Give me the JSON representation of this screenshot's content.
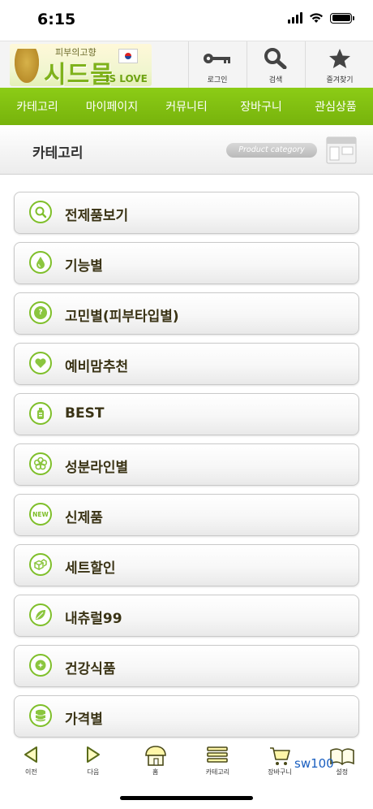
{
  "status_bar": {
    "time": "6:15"
  },
  "header": {
    "logo": {
      "subtitle": "피부의고향",
      "title": "시드물",
      "tagline": "IS LOVE"
    },
    "buttons": [
      {
        "label": "로그인",
        "icon": "key-icon"
      },
      {
        "label": "검색",
        "icon": "search-icon"
      },
      {
        "label": "즐겨찾기",
        "icon": "star-icon"
      }
    ]
  },
  "nav": {
    "items": [
      "카테고리",
      "마이페이지",
      "커뮤니티",
      "장바구니",
      "관심상품"
    ]
  },
  "category_bar": {
    "title": "카테고리",
    "badge": "Product category"
  },
  "menu": {
    "items": [
      {
        "label": "전제품보기",
        "icon": "magnifier-icon"
      },
      {
        "label": "기능별",
        "icon": "droplet-icon"
      },
      {
        "label": "고민별(피부타입별)",
        "icon": "question-icon"
      },
      {
        "label": "예비맘추천",
        "icon": "heart-icon"
      },
      {
        "label": "BEST",
        "icon": "bottle-icon"
      },
      {
        "label": "성분라인별",
        "icon": "flower-icon"
      },
      {
        "label": "신제품",
        "icon": "new-icon"
      },
      {
        "label": "세트할인",
        "icon": "boxes-icon"
      },
      {
        "label": "내츄럴99",
        "icon": "leaf-icon"
      },
      {
        "label": "건강식품",
        "icon": "health-icon"
      },
      {
        "label": "가격별",
        "icon": "coins-icon"
      }
    ]
  },
  "toolbar": {
    "items": [
      {
        "label": "이전",
        "icon": "back-icon"
      },
      {
        "label": "다음",
        "icon": "forward-icon"
      },
      {
        "label": "홈",
        "icon": "home-icon"
      },
      {
        "label": "카테고리",
        "icon": "category-icon"
      },
      {
        "label": "장바구니",
        "icon": "cart-icon"
      },
      {
        "label": "설정",
        "icon": "settings-icon"
      }
    ]
  },
  "overlay_text": "sw100",
  "colors": {
    "accent_green": "#7fb712",
    "text_dark": "#3b3416"
  }
}
